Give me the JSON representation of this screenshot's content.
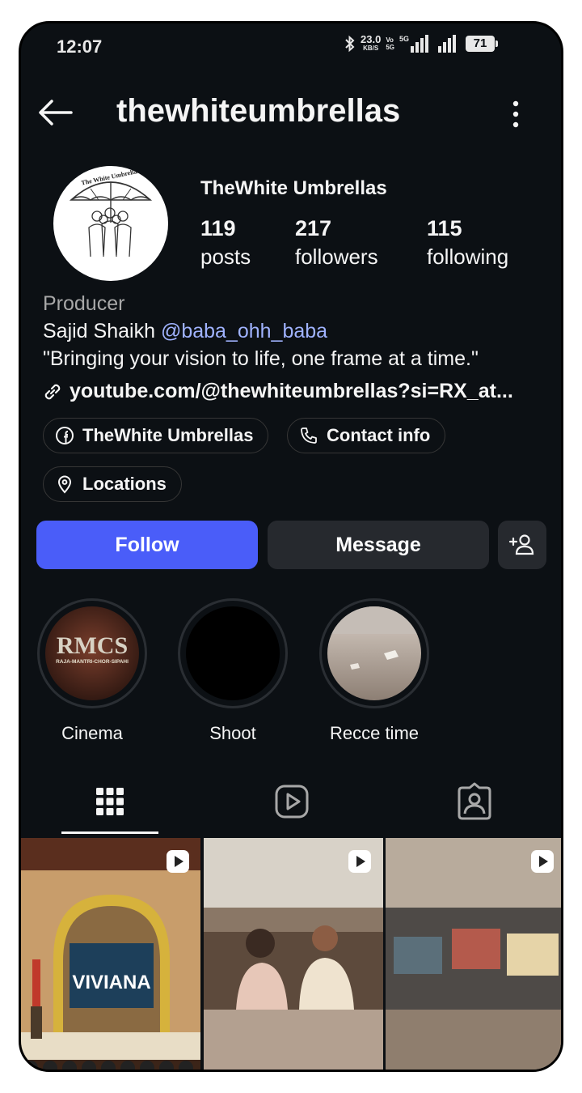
{
  "status_bar": {
    "time": "12:07",
    "net_speed": "23.0",
    "net_unit": "KB/S",
    "volte": "Vo",
    "volte_sub": "5G",
    "network_type": "5G",
    "battery": "71"
  },
  "header": {
    "username": "thewhiteumbrellas",
    "back_icon": "arrow-left-icon",
    "menu_icon": "more-vertical-icon"
  },
  "profile": {
    "display_name": "TheWhite Umbrellas",
    "avatar_logo_text": "The White Umbrellas",
    "stats": [
      {
        "number": "119",
        "label": "posts"
      },
      {
        "number": "217",
        "label": "followers"
      },
      {
        "number": "115",
        "label": "following"
      }
    ],
    "category": "Producer",
    "bio_line1_prefix": "Sajid Shaikh ",
    "bio_mention": "@baba_ohh_baba",
    "bio_line2": "\"Bringing your vision to life, one frame at a time.\"",
    "link": "youtube.com/@thewhiteumbrellas?si=RX_at..."
  },
  "chips": [
    {
      "label": "TheWhite Umbrellas",
      "icon": "facebook-icon"
    },
    {
      "label": "Contact info",
      "icon": "phone-icon"
    },
    {
      "label": "Locations",
      "icon": "location-pin-icon"
    }
  ],
  "actions": {
    "follow": "Follow",
    "message": "Message",
    "add_user_icon": "add-user-icon"
  },
  "highlights": [
    {
      "label": "Cinema",
      "cover_text": "RMCS",
      "cover_subtext": "RAJA-MANTRI-CHOR-SIPAHI"
    },
    {
      "label": "Shoot"
    },
    {
      "label": "Recce time"
    }
  ],
  "tabs": [
    {
      "icon": "grid-icon",
      "active": true
    },
    {
      "icon": "reels-icon",
      "active": false
    },
    {
      "icon": "tagged-icon",
      "active": false
    }
  ],
  "grid": [
    {
      "type": "reel",
      "overlay_text": "VIVIANA"
    },
    {
      "type": "reel",
      "overlay_text": ""
    },
    {
      "type": "reel",
      "overlay_text": ""
    }
  ],
  "colors": {
    "background": "#0c1014",
    "follow_button": "#4a5df9",
    "secondary_button": "#26292e",
    "mention": "#a0b3ff",
    "muted_text": "#a8a8a8"
  }
}
